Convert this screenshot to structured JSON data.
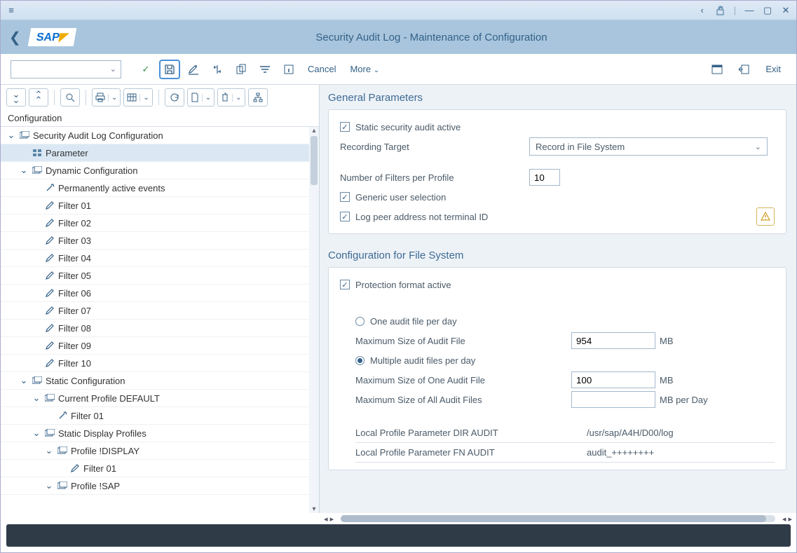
{
  "titlebar": {
    "icons": {
      "menu": "≡",
      "left": "‹",
      "unlock": "🔓",
      "min": "—",
      "max": "▢",
      "close": "✕"
    }
  },
  "header": {
    "logo": "SAP",
    "title": "Security Audit Log - Maintenance of Configuration"
  },
  "toolbar": {
    "cancel": "Cancel",
    "more": "More",
    "exit": "Exit"
  },
  "tree": {
    "header": "Configuration",
    "nodes": [
      {
        "indent": 0,
        "tw": "v",
        "icon": "folder-copy",
        "label": "Security Audit Log Configuration"
      },
      {
        "indent": 1,
        "tw": "",
        "icon": "params",
        "label": "Parameter",
        "selected": true
      },
      {
        "indent": 1,
        "tw": "v",
        "icon": "folder-copy",
        "label": "Dynamic Configuration"
      },
      {
        "indent": 2,
        "tw": "",
        "icon": "wand",
        "label": "Permanently active events"
      },
      {
        "indent": 2,
        "tw": "",
        "icon": "pencil",
        "label": "Filter 01"
      },
      {
        "indent": 2,
        "tw": "",
        "icon": "pencil",
        "label": "Filter 02"
      },
      {
        "indent": 2,
        "tw": "",
        "icon": "pencil",
        "label": "Filter 03"
      },
      {
        "indent": 2,
        "tw": "",
        "icon": "pencil",
        "label": "Filter 04"
      },
      {
        "indent": 2,
        "tw": "",
        "icon": "pencil",
        "label": "Filter 05"
      },
      {
        "indent": 2,
        "tw": "",
        "icon": "pencil",
        "label": "Filter 06"
      },
      {
        "indent": 2,
        "tw": "",
        "icon": "pencil",
        "label": "Filter 07"
      },
      {
        "indent": 2,
        "tw": "",
        "icon": "pencil",
        "label": "Filter 08"
      },
      {
        "indent": 2,
        "tw": "",
        "icon": "pencil",
        "label": "Filter 09"
      },
      {
        "indent": 2,
        "tw": "",
        "icon": "pencil",
        "label": "Filter 10"
      },
      {
        "indent": 1,
        "tw": "v",
        "icon": "folder-copy",
        "label": "Static Configuration"
      },
      {
        "indent": 2,
        "tw": "v",
        "icon": "folder-copy",
        "label": "Current Profile DEFAULT"
      },
      {
        "indent": 3,
        "tw": "",
        "icon": "wand",
        "label": "Filter 01"
      },
      {
        "indent": 2,
        "tw": "v",
        "icon": "folder-copy",
        "label": "Static Display Profiles"
      },
      {
        "indent": 3,
        "tw": "v",
        "icon": "folder-copy",
        "label": "Profile !DISPLAY"
      },
      {
        "indent": 4,
        "tw": "",
        "icon": "pencil",
        "label": "Filter 01"
      },
      {
        "indent": 3,
        "tw": "v",
        "icon": "folder-copy",
        "label": "Profile !SAP"
      }
    ]
  },
  "general": {
    "title": "General Parameters",
    "static_active_label": "Static security audit active",
    "static_active": true,
    "recording_target_label": "Recording Target",
    "recording_target_value": "Record in File System",
    "num_filters_label": "Number of Filters per Profile",
    "num_filters_value": "10",
    "generic_user_label": "Generic user selection",
    "generic_user": true,
    "log_peer_label": "Log peer address not terminal ID",
    "log_peer": true
  },
  "fileconfig": {
    "title": "Configuration for File System",
    "protection_label": "Protection format active",
    "protection": true,
    "one_per_day_label": "One audit file per day",
    "one_per_day": false,
    "max_file_label": "Maximum Size of Audit File",
    "max_file_value": "954",
    "max_file_unit": "MB",
    "multiple_label": "Multiple audit files per day",
    "multiple": true,
    "max_one_label": "Maximum Size of One Audit File",
    "max_one_value": "100",
    "max_one_unit": "MB",
    "max_all_label": "Maximum Size of All Audit Files",
    "max_all_value": "",
    "max_all_unit": "MB per Day",
    "dir_audit_label": "Local Profile Parameter DIR AUDIT",
    "dir_audit_value": "/usr/sap/A4H/D00/log",
    "fn_audit_label": "Local Profile Parameter FN AUDIT",
    "fn_audit_value": "audit_++++++++"
  }
}
